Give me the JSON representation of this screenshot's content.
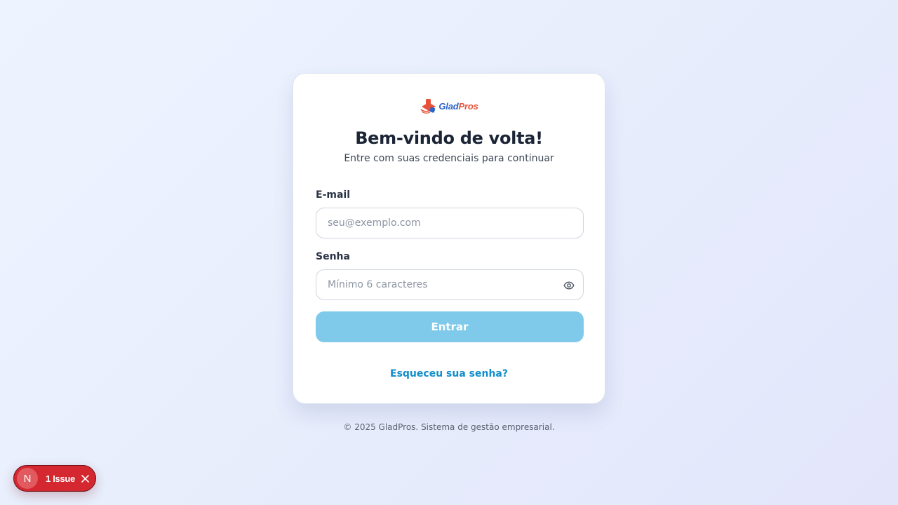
{
  "brand": {
    "logo_text_part1": "Glad",
    "logo_text_part2": "Pros",
    "logo_icon": "gladpros-logo-icon"
  },
  "login": {
    "title": "Bem-vindo de volta!",
    "subtitle": "Entre com suas credenciais para continuar",
    "email_label": "E-mail",
    "email_value": "",
    "email_placeholder": "seu@exemplo.com",
    "password_label": "Senha",
    "password_value": "",
    "password_placeholder": "Mínimo 6 caracteres",
    "password_toggle_icon": "eye-icon",
    "submit_label": "Entrar",
    "forgot_link": "Esqueceu sua senha?"
  },
  "footer": {
    "text": "© 2025 GladPros. Sistema de gestão empresarial."
  },
  "dev_overlay": {
    "badge_letter": "N",
    "issue_label": "1 Issue",
    "close_icon": "close-icon"
  },
  "colors": {
    "primary_button": "#7fcaeb",
    "link": "#118ecb",
    "issue_badge": "#d5272f",
    "logo_blue": "#2d63c8",
    "logo_orange": "#e8523a"
  }
}
